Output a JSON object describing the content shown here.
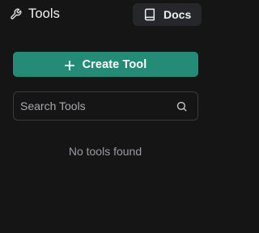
{
  "header": {
    "title": "Tools",
    "title_icon": "wrench-icon",
    "docs_button": {
      "label": "Docs",
      "icon": "book-icon"
    }
  },
  "create_button": {
    "label": "Create Tool",
    "icon": "plus-icon",
    "color": "#238b76"
  },
  "search": {
    "placeholder": "Search Tools",
    "value": "",
    "icon": "search-icon"
  },
  "empty_state": {
    "message": "No tools found"
  },
  "colors": {
    "background": "#151516",
    "accent": "#238b76",
    "docs_button_bg": "#26272a",
    "muted_text": "#9b9ca2"
  }
}
